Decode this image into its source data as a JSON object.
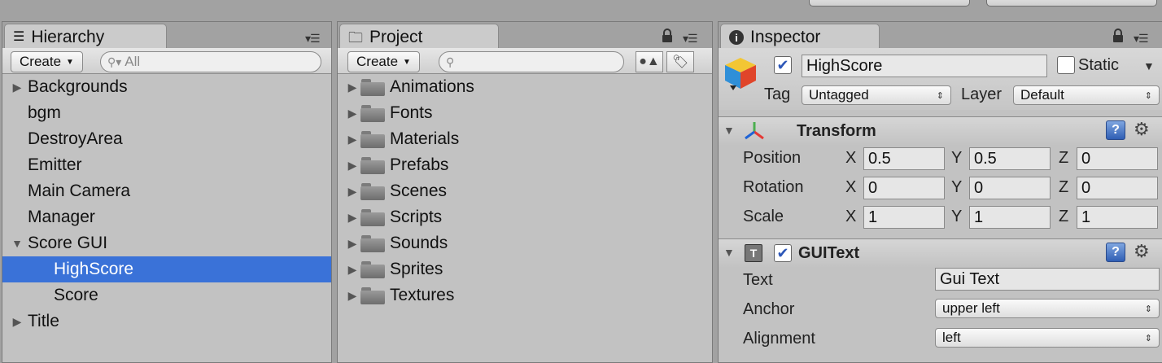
{
  "topbar": {
    "buttons": [
      "",
      ""
    ]
  },
  "hierarchy": {
    "tab_label": "Hierarchy",
    "create_label": "Create",
    "search_placeholder": "All",
    "items": [
      {
        "label": "Backgrounds",
        "expander": "▶"
      },
      {
        "label": "bgm",
        "expander": ""
      },
      {
        "label": "DestroyArea",
        "expander": ""
      },
      {
        "label": "Emitter",
        "expander": ""
      },
      {
        "label": "Main Camera",
        "expander": ""
      },
      {
        "label": "Manager",
        "expander": ""
      },
      {
        "label": "Score GUI",
        "expander": "▼"
      },
      {
        "label": "HighScore",
        "expander": "",
        "selected": true,
        "child": true
      },
      {
        "label": "Score",
        "expander": "",
        "child": true
      },
      {
        "label": "Title",
        "expander": "▶"
      }
    ]
  },
  "project": {
    "tab_label": "Project",
    "create_label": "Create",
    "search_value": "",
    "folders": [
      "Animations",
      "Fonts",
      "Materials",
      "Prefabs",
      "Scenes",
      "Scripts",
      "Sounds",
      "Sprites",
      "Textures"
    ]
  },
  "inspector": {
    "tab_label": "Inspector",
    "object_name": "HighScore",
    "active_checked": true,
    "static_label": "Static",
    "static_checked": false,
    "tag_label": "Tag",
    "tag_value": "Untagged",
    "layer_label": "Layer",
    "layer_value": "Default",
    "transform": {
      "title": "Transform",
      "rows": [
        {
          "label": "Position",
          "x": "0.5",
          "y": "0.5",
          "z": "0"
        },
        {
          "label": "Rotation",
          "x": "0",
          "y": "0",
          "z": "0"
        },
        {
          "label": "Scale",
          "x": "1",
          "y": "1",
          "z": "1"
        }
      ],
      "axis_x": "X",
      "axis_y": "Y",
      "axis_z": "Z"
    },
    "guitext": {
      "title": "GUIText",
      "enabled": true,
      "icon_letter": "T",
      "text_label": "Text",
      "text_value": "Gui Text",
      "anchor_label": "Anchor",
      "anchor_value": "upper left",
      "alignment_label": "Alignment",
      "alignment_value": "left"
    },
    "help_glyph": "?"
  }
}
